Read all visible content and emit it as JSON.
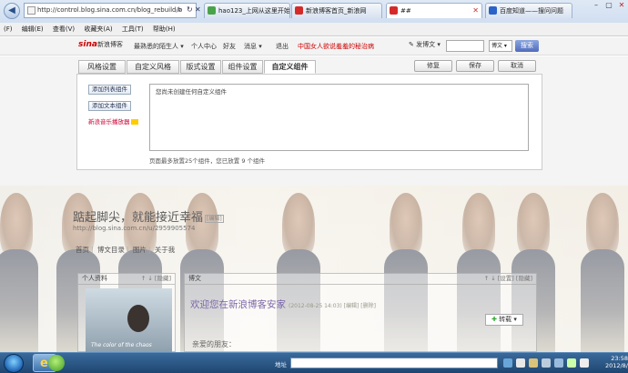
{
  "browser": {
    "address": "http://control.blog.sina.com.cn/blog_rebuild/b",
    "address_host": "sina.com.cn",
    "tabs": [
      {
        "label": "hao123_上网从这里开始",
        "active": false,
        "color": "#4aa34a"
      },
      {
        "label": "新浪博客首页_新浪网",
        "active": false,
        "color": "#d52a2a"
      },
      {
        "label": "##",
        "active": true,
        "color": "#d52a2a"
      },
      {
        "label": "百度知道——搜问问题",
        "active": false,
        "color": "#2b63c8"
      }
    ],
    "menu": [
      "(F)",
      "编辑(E)",
      "查看(V)",
      "收藏夹(A)",
      "工具(T)",
      "帮助(H)"
    ]
  },
  "sinabar": {
    "logo": "sina",
    "logo_sub": "新浪博客",
    "user_menu": "最熟悉的陌生人 ▾",
    "personal_center": "个人中心",
    "friends": "好友",
    "messages": "消息 ▾",
    "logout": "退出",
    "promo": "中国女人欲说羞羞的秘治病",
    "publish": "✎ 发博文 ▾",
    "search_placeholder": "",
    "search_scope": "博文 ▾",
    "search_button": "搜索"
  },
  "settings": {
    "tabs": [
      "风格设置",
      "自定义风格",
      "版式设置",
      "组件设置",
      "自定义组件"
    ],
    "active_tab": 4,
    "actions": {
      "restore": "修复",
      "save": "保存",
      "cancel": "取消"
    },
    "add_list": "添加列表组件",
    "add_text": "添加文本组件",
    "music_link": "新浪音乐播放器",
    "empty_text": "您尚未创建任何自定义组件",
    "footer": "页面最多放置25个组件，您已放置 9 个组件"
  },
  "blog": {
    "title": "踮起脚尖，就能接近幸福",
    "title_edit": "[编辑]",
    "url": "http://blog.sina.com.cn/u/2959905574",
    "nav": [
      "首页",
      "博文目录",
      "图片",
      "关于我"
    ],
    "profile_head": "个人资料",
    "profile_ctrl": "↑ ↓ [隐藏]",
    "avatar_caption": "The color of the chaos",
    "article_head": "博文",
    "article_ctrl": "↑ ↓ [设置] [隐藏]",
    "welcome": "欢迎您在新浪博客安家",
    "welcome_meta": "(2012-08-25 14:03) [编辑] [删除]",
    "reprint": "转载",
    "greeting": "亲爱的朋友："
  },
  "taskbar": {
    "address_label": "地址",
    "time": "23:58",
    "date": "2012/8/"
  }
}
